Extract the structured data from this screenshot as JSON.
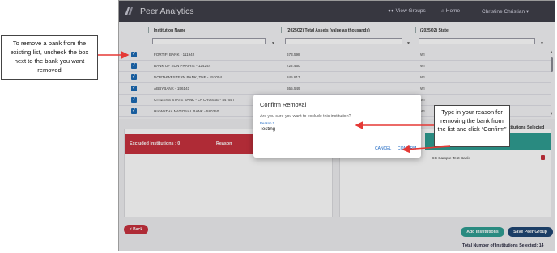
{
  "annotations": {
    "left_note": "To remove a bank from the existing list, uncheck the box next to the bank you want removed",
    "right_note": "Type in your reason for removing the bank from the list and click “Confirm”"
  },
  "header": {
    "brand": "Peer Analytics",
    "nav": [
      "View Groups",
      "Home",
      "Christine Christian ▾"
    ]
  },
  "table": {
    "columns": [
      "Institution Name",
      "(2025Q2) Total Assets (value as thousands)",
      "(2025Q2) State"
    ],
    "rows": [
      [
        "FORTIFI BANK - 111942",
        "673.598",
        "WI"
      ],
      [
        "BANK OF SUN PRAIRIE - 124244",
        "722.460",
        "WI"
      ],
      [
        "NORTHWESTERN BANK, THE - 153054",
        "845.817",
        "WI"
      ],
      [
        "ABBYBANK - 156141",
        "655.549",
        "WI"
      ],
      [
        "CITIZENS STATE BANK - LA CROSSE - 447557",
        "",
        "WI"
      ],
      [
        "HIAWATHA NATIONAL BANK - 580350",
        "",
        "WI"
      ]
    ]
  },
  "excluded_panel": {
    "title": "Excluded Institutions : 0",
    "reason_col": "Reason"
  },
  "selected_panel": {
    "title": "nstitutions Selected",
    "row_name": "CC Sample Test Bank"
  },
  "buttons": {
    "back": "< Back",
    "add": "Add Institutions",
    "save": "Save Peer Group"
  },
  "total_text": "Total Number of Institutions Selected: 14",
  "modal": {
    "title": "Confirm Removal",
    "question": "Are you sure you want to exclude this institution?",
    "field_label": "Reason *",
    "field_value": "Testing",
    "cancel": "CANCEL",
    "confirm": "CONFIRM"
  },
  "colors": {
    "topbar": "#3f3f49",
    "checkbox": "#1c6ab4",
    "excluded_header": "#c8323e",
    "selected_header": "#2f9e92",
    "save_button": "#1f4673",
    "arrow": "#e53935"
  }
}
